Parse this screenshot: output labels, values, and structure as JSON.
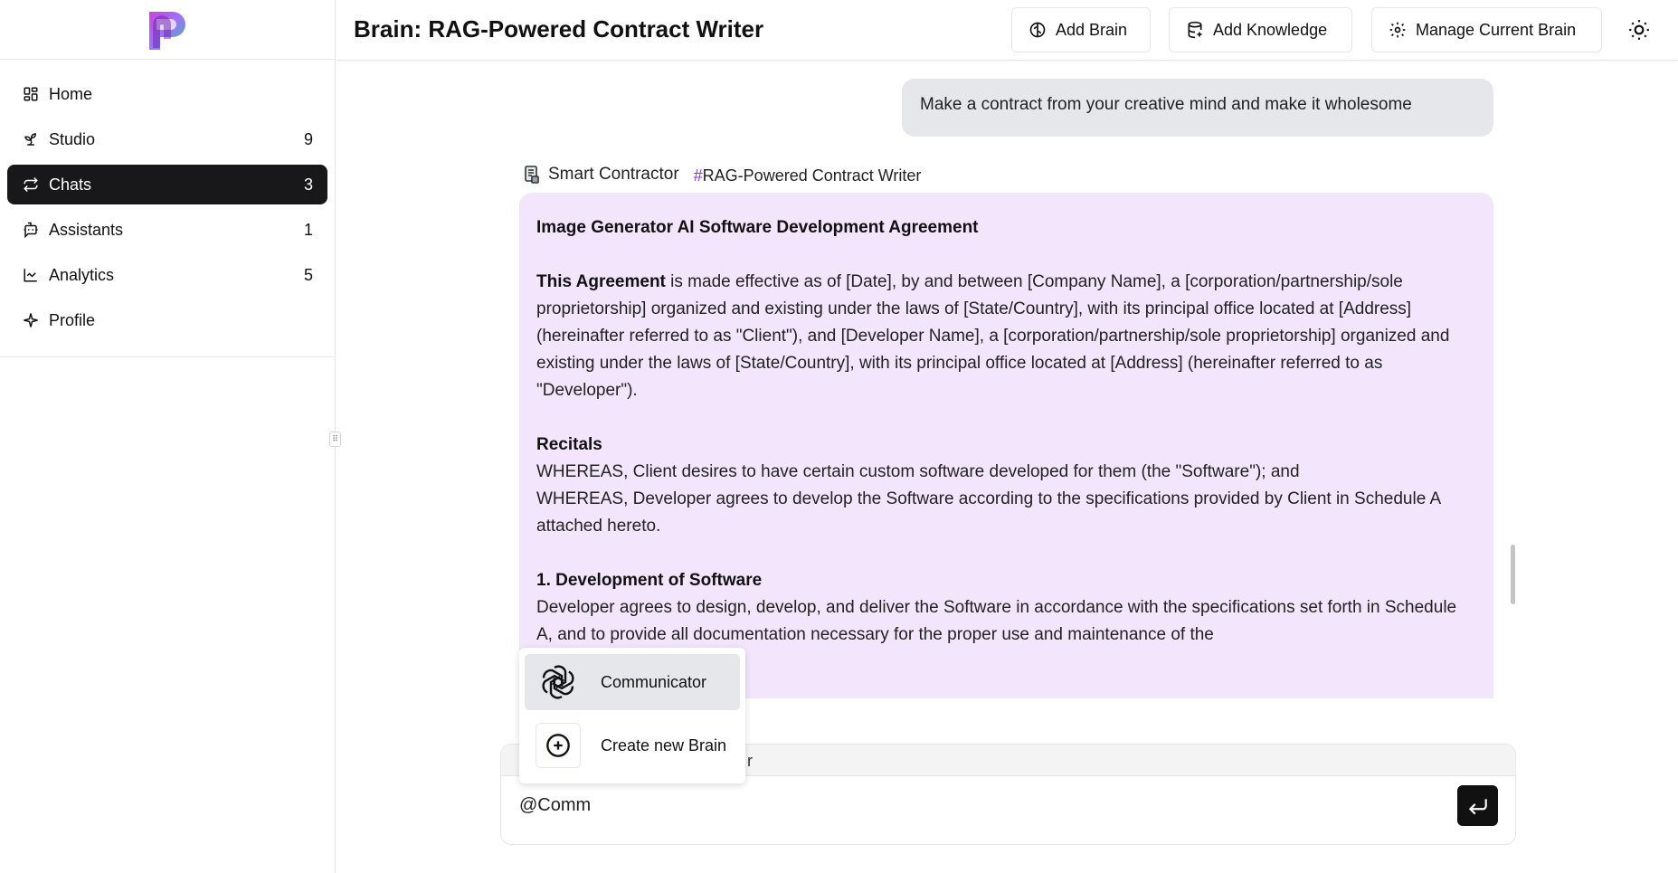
{
  "header": {
    "title": "Brain: RAG-Powered Contract Writer",
    "add_brain": "Add Brain",
    "add_knowledge": "Add Knowledge",
    "manage_brain": "Manage Current Brain"
  },
  "sidebar": {
    "items": [
      {
        "label": "Home",
        "count": "",
        "icon": "home-icon"
      },
      {
        "label": "Studio",
        "count": "9",
        "icon": "studio-icon"
      },
      {
        "label": "Chats",
        "count": "3",
        "icon": "chats-icon"
      },
      {
        "label": "Assistants",
        "count": "1",
        "icon": "assistants-icon"
      },
      {
        "label": "Analytics",
        "count": "5",
        "icon": "analytics-icon"
      },
      {
        "label": "Profile",
        "count": "",
        "icon": "profile-icon"
      }
    ],
    "active": "Chats"
  },
  "chat": {
    "user_message": "Make a contract from your creative mind and make it wholesome",
    "assistant_name": "Smart Contractor",
    "brain_tag_hash": "#",
    "brain_tag": "RAG-Powered Contract Writer",
    "doc_title": "Image Generator AI Software Development Agreement",
    "intro_bold": "This Agreement",
    "intro_rest": " is made effective as of [Date], by and between [Company Name], a [corporation/partnership/sole proprietorship] organized and existing under the laws of [State/Country], with its principal office located at [Address] (hereinafter referred to as \"Client\"), and [Developer Name], a [corporation/partnership/sole proprietorship] organized and existing under the laws of [State/Country], with its principal office located at [Address] (hereinafter referred to as \"Developer\").",
    "recitals_title": "Recitals",
    "recital_1": "WHEREAS, Client desires to have certain custom software developed for them (the \"Software\"); and",
    "recital_2": "WHEREAS, Developer agrees to develop the Software according to the specifications provided by Client in Schedule A attached hereto.",
    "section1_title": "1. Development of Software",
    "section1_text": "Developer agrees to design, develop, and deliver the Software in accordance with the specifications set forth in Schedule A, and to provide all documentation necessary for the proper use and maintenance of the"
  },
  "input": {
    "value": "@Comm",
    "brain_label_partial": "r"
  },
  "mention_menu": {
    "items": [
      {
        "label": "Communicator",
        "icon": "openai-icon"
      },
      {
        "label": "Create new Brain",
        "icon": "plus-circle-icon"
      }
    ]
  },
  "colors": {
    "active_nav": "#18181b",
    "assistant_bubble": "#f3e5fb",
    "user_bubble": "#e5e7eb",
    "brain_hash": "#9333ea"
  }
}
